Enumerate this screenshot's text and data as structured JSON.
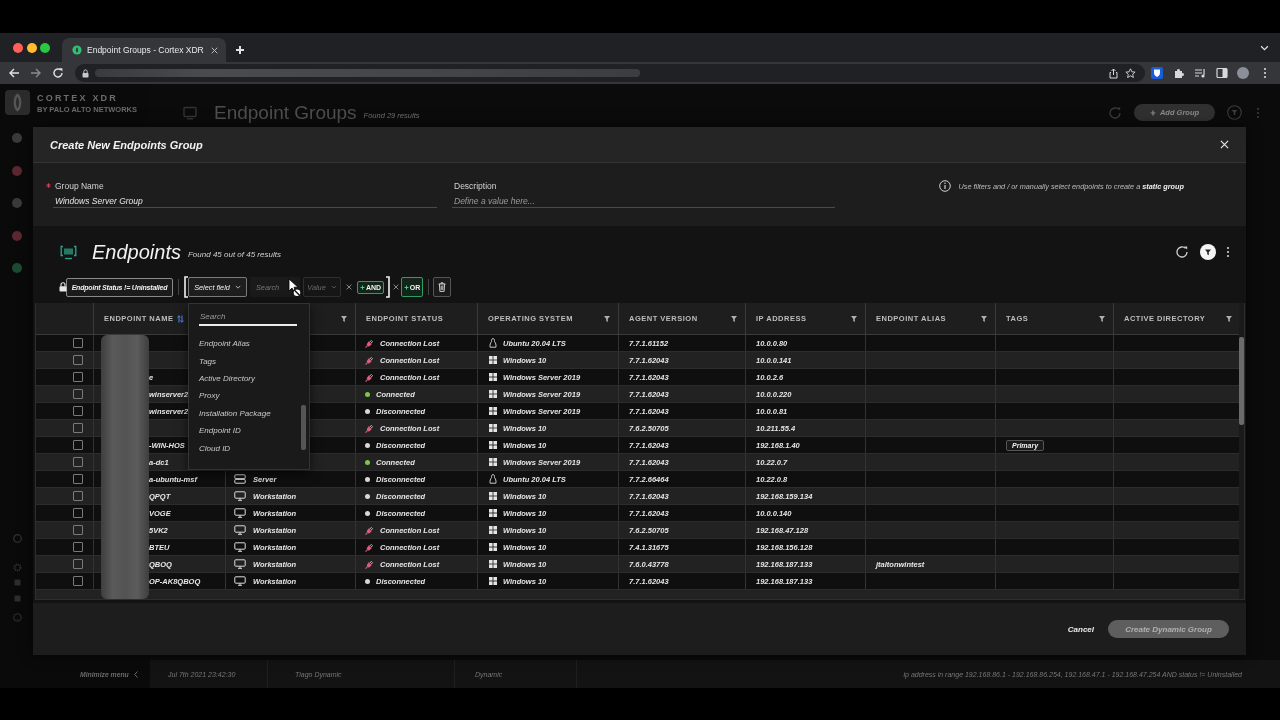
{
  "browser": {
    "tab_title": "Endpoint Groups - Cortex XDR"
  },
  "app": {
    "logo_name": "CORTEX XDR",
    "logo_tagline": "BY PALO ALTO NETWORKS",
    "nav_icons": [
      {
        "color": "#3a3a3a"
      },
      {
        "color": "#5b2731"
      },
      {
        "color": "#3a3a3a"
      },
      {
        "color": "#5b2731"
      },
      {
        "color": "#1d4a32"
      }
    ],
    "page_title": "Endpoint Groups",
    "page_count": "Found 29 results",
    "add_button": "Add Group",
    "minimize_menu": "Minimize menu",
    "group_row": {
      "cells": [
        "Jul 7th 2021 23:42:30",
        "Tiago Dynamic",
        "Dynamic",
        "ip address in range 192.168.86.1 - 192.168.86.254, 192.168.47.1 - 192.168.47.254 AND status != Uninstalled"
      ]
    }
  },
  "modal": {
    "title": "Create New Endpoints Group",
    "fields": [
      {
        "label": "Group Name",
        "required": true,
        "value": "Windows Server Group"
      },
      {
        "label": "Description",
        "required": false,
        "placeholder": "Define a value here..."
      }
    ],
    "hint": "Use filters and / or manually select endpoints to create a **static group**",
    "endpoints": {
      "title": "Endpoints",
      "count": "Found 45 out of 45 results",
      "filter_bar": {
        "locked_filter": "Endpoint Status != Uninstalled",
        "field_select": "Select field",
        "search": {
          "placeholder": "Search"
        },
        "value_select": {
          "label": "Value",
          "disabled": true
        },
        "and_button": "AND",
        "or_button": "OR"
      },
      "field_menu": {
        "search": {
          "placeholder": "Search"
        },
        "items": [
          "Endpoint Alias",
          "Tags",
          "Active Directory",
          "Proxy",
          "Installation Package",
          "Endpoint ID",
          "Cloud ID"
        ]
      },
      "table": {
        "columns": [
          {
            "label": "ENDPOINT NAME",
            "sorted": true,
            "filter": false
          },
          {
            "sorted": false,
            "filter": true
          },
          {
            "label": "ENDPOINT STATUS",
            "sorted": false,
            "filter": false
          },
          {
            "label": "OPERATING SYSTEM",
            "sorted": false,
            "filter": true
          },
          {
            "label": "AGENT VERSION",
            "sorted": false,
            "filter": true
          },
          {
            "label": "IP ADDRESS",
            "sorted": false,
            "filter": true
          },
          {
            "label": "ENDPOINT ALIAS",
            "sorted": false,
            "filter": true
          },
          {
            "label": "TAGS",
            "sorted": false,
            "filter": true
          },
          {
            "label": "ACTIVE DIRECTORY",
            "sorted": false,
            "filter": true
          }
        ],
        "rows": [
          {
            "checked": false,
            "status": {
              "text": "Connection Lost",
              "kind": "lost"
            },
            "os": {
              "text": "Ubuntu 20.04 LTS",
              "kind": "linux"
            },
            "agent_version": "7.7.1.61152",
            "ip_address": "10.0.0.80"
          },
          {
            "checked": false,
            "status": {
              "text": "Connection Lost",
              "kind": "lost"
            },
            "os": {
              "text": "Windows 10",
              "kind": "windows"
            },
            "agent_version": "7.7.1.62043",
            "ip_address": "10.0.0.141"
          },
          {
            "checked": false,
            "name": "e",
            "status": {
              "text": "Connection Lost",
              "kind": "lost"
            },
            "os": {
              "text": "Windows Server 2019",
              "kind": "windows"
            },
            "agent_version": "7.7.1.62043",
            "ip_address": "10.0.2.6"
          },
          {
            "checked": false,
            "name": "winserver2",
            "status": {
              "text": "Connected",
              "kind": "connected"
            },
            "os": {
              "text": "Windows Server 2019",
              "kind": "windows"
            },
            "agent_version": "7.7.1.62043",
            "ip_address": "10.0.0.220"
          },
          {
            "checked": false,
            "name": "winserver2",
            "status": {
              "text": "Disconnected",
              "kind": "disconnected"
            },
            "os": {
              "text": "Windows Server 2019",
              "kind": "windows"
            },
            "agent_version": "7.7.1.62043",
            "ip_address": "10.0.0.81"
          },
          {
            "checked": false,
            "status": {
              "text": "Connection Lost",
              "kind": "lost"
            },
            "os": {
              "text": "Windows 10",
              "kind": "windows"
            },
            "agent_version": "7.6.2.50705",
            "ip_address": "10.211.55.4"
          },
          {
            "checked": false,
            "name": "-WIN-HOS",
            "status": {
              "text": "Disconnected",
              "kind": "disconnected"
            },
            "os": {
              "text": "Windows 10",
              "kind": "windows"
            },
            "agent_version": "7.7.1.62043",
            "ip_address": "192.168.1.40",
            "tags": [
              "Primary"
            ]
          },
          {
            "checked": false,
            "name": "a-dc1",
            "status": {
              "text": "Connected",
              "kind": "connected"
            },
            "os": {
              "text": "Windows Server 2019",
              "kind": "windows"
            },
            "agent_version": "7.7.1.62043",
            "ip_address": "10.22.0.7"
          },
          {
            "checked": false,
            "name": "a-ubuntu-msf",
            "type": {
              "text": "Server",
              "kind": "server"
            },
            "status": {
              "text": "Disconnected",
              "kind": "disconnected"
            },
            "os": {
              "text": "Ubuntu 20.04 LTS",
              "kind": "linux"
            },
            "agent_version": "7.7.2.66464",
            "ip_address": "10.22.0.8"
          },
          {
            "checked": false,
            "name": "QPQT",
            "type": {
              "text": "Workstation",
              "kind": "workstation"
            },
            "status": {
              "text": "Disconnected",
              "kind": "disconnected"
            },
            "os": {
              "text": "Windows 10",
              "kind": "windows"
            },
            "agent_version": "7.7.1.62043",
            "ip_address": "192.168.159.134"
          },
          {
            "checked": false,
            "name": "VOGE",
            "type": {
              "text": "Workstation",
              "kind": "workstation"
            },
            "status": {
              "text": "Disconnected",
              "kind": "disconnected"
            },
            "os": {
              "text": "Windows 10",
              "kind": "windows"
            },
            "agent_version": "7.7.1.62043",
            "ip_address": "10.0.0.140"
          },
          {
            "checked": false,
            "name": "5VK2",
            "type": {
              "text": "Workstation",
              "kind": "workstation"
            },
            "status": {
              "text": "Connection Lost",
              "kind": "lost"
            },
            "os": {
              "text": "Windows 10",
              "kind": "windows"
            },
            "agent_version": "7.6.2.50705",
            "ip_address": "192.168.47.128"
          },
          {
            "checked": false,
            "name": "BTEU",
            "type": {
              "text": "Workstation",
              "kind": "workstation"
            },
            "status": {
              "text": "Connection Lost",
              "kind": "lost"
            },
            "os": {
              "text": "Windows 10",
              "kind": "windows"
            },
            "agent_version": "7.4.1.31675",
            "ip_address": "192.168.156.128"
          },
          {
            "checked": false,
            "name": "QBOQ",
            "type": {
              "text": "Workstation",
              "kind": "workstation"
            },
            "status": {
              "text": "Connection Lost",
              "kind": "lost"
            },
            "os": {
              "text": "Windows 10",
              "kind": "windows"
            },
            "agent_version": "7.6.0.43778",
            "ip_address": "192.168.187.133",
            "alias": "jtaltonwintest"
          },
          {
            "checked": false,
            "name": "OP-AK8QBOQ",
            "type": {
              "text": "Workstation",
              "kind": "workstation"
            },
            "status": {
              "text": "Disconnected",
              "kind": "disconnected"
            },
            "os": {
              "text": "Windows 10",
              "kind": "windows"
            },
            "agent_version": "7.7.1.62043",
            "ip_address": "192.168.187.133"
          }
        ]
      }
    },
    "buttons": [
      {
        "label": "Cancel",
        "kind": "link",
        "disabled": false
      },
      {
        "label": "Create Dynamic Group",
        "kind": "primary",
        "disabled": true
      }
    ]
  }
}
